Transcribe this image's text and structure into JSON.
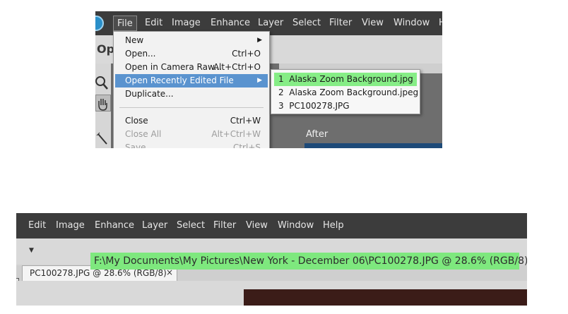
{
  "shot1": {
    "menubar": {
      "items": [
        "File",
        "Edit",
        "Image",
        "Enhance",
        "Layer",
        "Select",
        "Filter",
        "View",
        "Window",
        "H"
      ],
      "active": "File"
    },
    "options_label": "Op",
    "file_menu": {
      "items": [
        {
          "label": "New",
          "shortcut": "",
          "submenu": true
        },
        {
          "label": "Open...",
          "shortcut": "Ctrl+O"
        },
        {
          "label": "Open in Camera Raw...",
          "shortcut": "Alt+Ctrl+O"
        },
        {
          "label": "Open Recently Edited File",
          "shortcut": "",
          "submenu": true,
          "highlighted": true
        },
        {
          "label": "Duplicate...",
          "shortcut": ""
        },
        {
          "label": "Close",
          "shortcut": "Ctrl+W"
        },
        {
          "label": "Close All",
          "shortcut": "Alt+Ctrl+W",
          "disabled": true
        },
        {
          "label": "Save",
          "shortcut": "Ctrl+S",
          "disabled": true
        }
      ]
    },
    "recent_files": [
      {
        "index": "1",
        "name": "Alaska Zoom Background.jpg"
      },
      {
        "index": "2",
        "name": "Alaska Zoom Background.jpeg"
      },
      {
        "index": "3",
        "name": "PC100278.JPG"
      }
    ],
    "after_label": "After",
    "colors": {
      "menubar": "#3c3c3c",
      "highlight": "#5a93cf",
      "green": "#86ed86"
    }
  },
  "shot2": {
    "menubar": {
      "items": [
        "Edit",
        "Image",
        "Enhance",
        "Layer",
        "Select",
        "Filter",
        "View",
        "Window",
        "Help"
      ]
    },
    "title_path": "F:\\My Documents\\My Pictures\\New York - December 06\\PC100278.JPG @ 28.6% (RGB/8)",
    "doc_tab": "PC100278.JPG @ 28.6% (RGB/8)",
    "tab_close": "×"
  }
}
